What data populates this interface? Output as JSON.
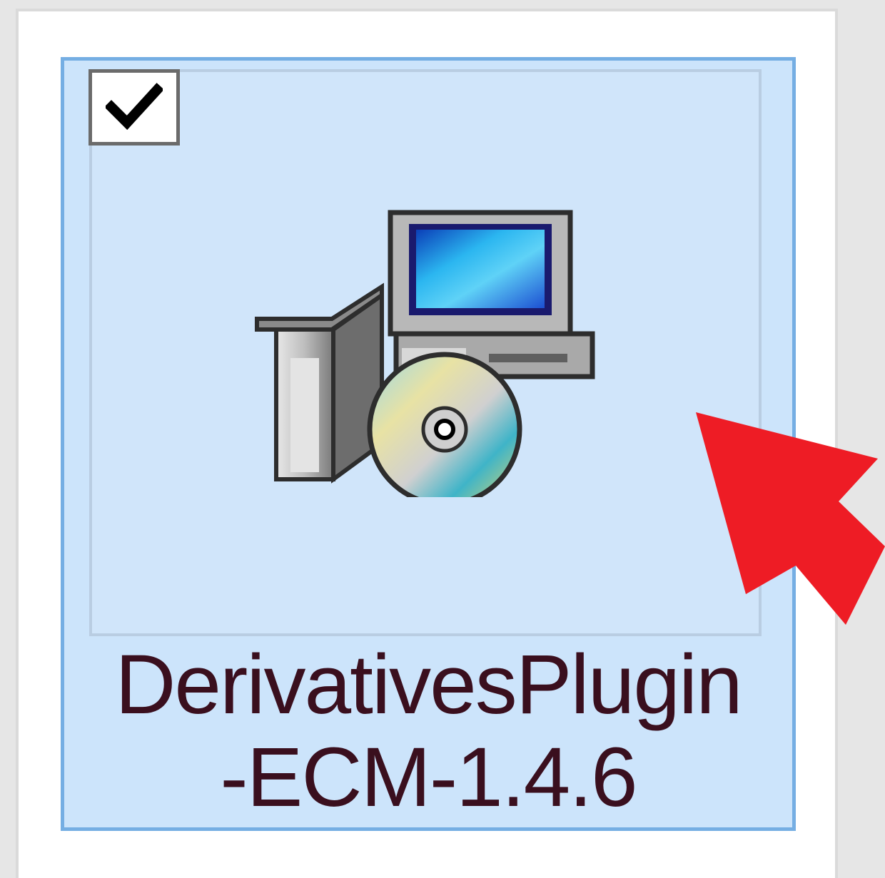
{
  "file": {
    "name_line1": "DerivativesPlugin",
    "name_line2": "-ECM-1.4.6",
    "selected": true,
    "checked": true,
    "icon": "installer-package-icon"
  },
  "annotation": {
    "icon": "red-arrow-pointer-icon",
    "color": "#ee1c25"
  },
  "colors": {
    "selection_fill": "#cce4fb",
    "selection_border": "#75aee3",
    "label_text": "#3a0f1e"
  }
}
